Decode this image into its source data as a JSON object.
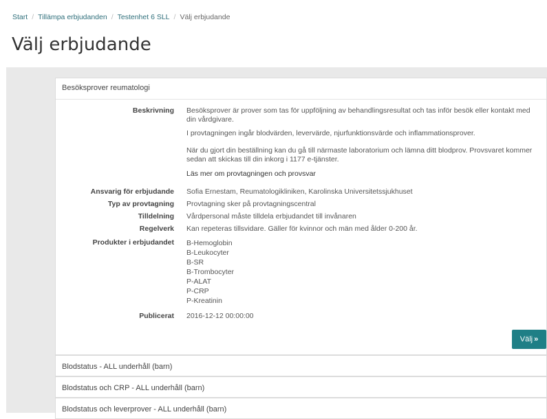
{
  "breadcrumb": {
    "items": [
      "Start",
      "Tillämpa erbjudanden",
      "Testenhet 6 SLL"
    ],
    "current": "Välj erbjudande",
    "separator": "/"
  },
  "page_title": "Välj erbjudande",
  "offer": {
    "title": "Besöksprover reumatologi",
    "fields": {
      "beskrivning_label": "Beskrivning",
      "beskrivning_p1": "Besöksprover är prover som tas för uppföljning av behandlingsresultat och tas inför besök eller kontakt med din vårdgivare.",
      "beskrivning_p2": "I provtagningen ingår blodvärden, levervärde, njurfunktionsvärde och inflammationsprover.",
      "beskrivning_p3": "När du gjort din beställning kan du gå till närmaste laboratorium och lämna ditt blodprov. Provsvaret kommer sedan att skickas till din inkorg i 1177 e-tjänster.",
      "beskrivning_link": "Läs mer om provtagningen och provsvar",
      "ansvarig_label": "Ansvarig för erbjudande",
      "ansvarig_value": "Sofia Ernestam, Reumatologikliniken, Karolinska Universitetssjukhuset",
      "typ_label": "Typ av provtagning",
      "typ_value": "Provtagning sker på provtagningscentral",
      "tilldelning_label": "Tilldelning",
      "tilldelning_value": "Vårdpersonal måste tilldela erbjudandet till invånaren",
      "regelverk_label": "Regelverk",
      "regelverk_value": "Kan repeteras tillsvidare. Gäller för kvinnor och män med ålder 0-200 år.",
      "produkter_label": "Produkter i erbjudandet",
      "produkter": [
        "B-Hemoglobin",
        "B-Leukocyter",
        "B-SR",
        "B-Trombocyter",
        "P-ALAT",
        "P-CRP",
        "P-Kreatinin"
      ],
      "publicerat_label": "Publicerat",
      "publicerat_value": "2016-12-12 00:00:00"
    },
    "select_button": "Välj",
    "select_button_icon": "»"
  },
  "other_offers": [
    "Blodstatus - ALL underhåll (barn)",
    "Blodstatus och CRP - ALL underhåll (barn)",
    "Blodstatus och leverprover - ALL underhåll (barn)"
  ],
  "colors": {
    "accent": "#1f7f86",
    "link": "#2f6f7b",
    "background": "#e9e9e9"
  }
}
